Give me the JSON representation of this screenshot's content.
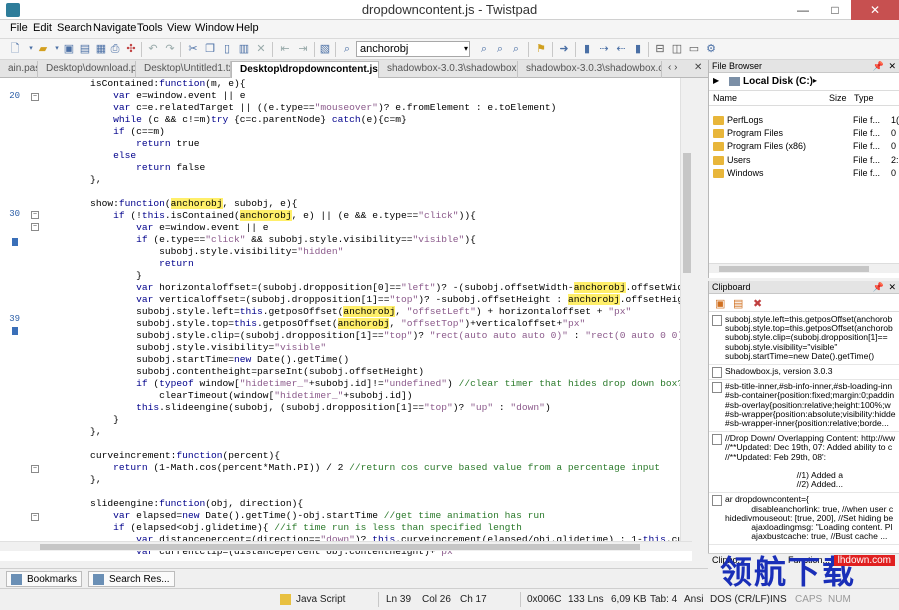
{
  "window": {
    "title": "dropdowncontent.js - Twistpad",
    "min": "—",
    "max": "□",
    "close": "✕"
  },
  "menu": [
    "File",
    "Edit",
    "Search",
    "Navigate",
    "Tools",
    "View",
    "Window",
    "Help"
  ],
  "toolbar": {
    "search_value": "anchorobj"
  },
  "tabs": [
    {
      "label": "ain.pas"
    },
    {
      "label": "Desktop\\download.php"
    },
    {
      "label": "Desktop\\Untitled1.txt"
    },
    {
      "label": "Desktop\\dropdowncontent.js",
      "active": true
    },
    {
      "label": "shadowbox-3.0.3\\shadowbox.js*"
    },
    {
      "label": "shadowbox-3.0.3\\shadowbox.css"
    }
  ],
  "tab_nav": "‹ ›",
  "tab_close": "✕",
  "line_numbers": {
    "l20": "20",
    "l30": "30",
    "l39": "39"
  },
  "file_browser": {
    "title": "File Browser",
    "location": "Local Disk (C:)",
    "columns": [
      "Name",
      "Size",
      "Type"
    ],
    "items": [
      {
        "name": "PerfLogs",
        "type": "File f...",
        "extra": "1("
      },
      {
        "name": "Program Files",
        "type": "File f...",
        "extra": "0"
      },
      {
        "name": "Program Files (x86)",
        "type": "File f...",
        "extra": "0"
      },
      {
        "name": "Users",
        "type": "File f...",
        "extra": "2:"
      },
      {
        "name": "Windows",
        "type": "File f...",
        "extra": "0"
      }
    ]
  },
  "clipboard": {
    "title": "Clipboard",
    "entries": [
      {
        "lines": [
          "subobj.style.left=this.getposOffset(anchorob",
          "subobj.style.top=this.getposOffset(anchorob",
          "subobj.style.clip=(subobj.dropposition[1]==",
          "subobj.style.visibility=\"visible\"",
          "subobj.startTime=new Date().getTime()"
        ]
      },
      {
        "lines": [
          "Shadowbox.js, version 3.0.3"
        ]
      },
      {
        "lines": [
          "#sb-title-inner,#sb-info-inner,#sb-loading-inn",
          "#sb-container{position:fixed;margin:0;paddin",
          "#sb-overlay{position:relative;height:100%;w",
          "#sb-wrapper{position:absolute;visibility:hidde",
          "#sb-wrapper-inner{position:relative;borde..."
        ]
      },
      {
        "lines": [
          "//Drop Down/ Overlapping Content: http://ww",
          "//**Updated: Dec 19th, 07: Added ability to c",
          "//**Updated: Feb 29th, 08':",
          "",
          "                              //1) Added a",
          "                              //2) Added..."
        ]
      },
      {
        "lines": [
          "ar dropdowncontent={",
          "           disableanchorlink: true, //when user c",
          "hidedivmouseout: [true, 200], //Set hiding be",
          "           ajaxloadingmsg: \"Loading content. Pl",
          "           ajaxbustcache: true, //Bust cache ..."
        ]
      }
    ]
  },
  "bottom_tabs": [
    "Bookmarks",
    "Search Res..."
  ],
  "side_tabs": [
    "Clipbo...",
    "Function..."
  ],
  "status": {
    "lang": "Java Script",
    "ln": "Ln  39",
    "col": "Col  26",
    "ch": "Ch  17",
    "code": "0x006C",
    "lines": "133 Lns",
    "size": "6,09 KB",
    "tab": "Tab: 4",
    "enc": "Ansi",
    "eol": "DOS (CR/LF)",
    "ins": "INS",
    "caps": "CAPS",
    "num": "NUM"
  },
  "watermark": {
    "text": "领航下载",
    "url": "lhdown.com"
  },
  "code": [
    {
      "t": "        isContained:function(m, e){"
    },
    {
      "t": "            var e=window.event || e",
      "k": true
    },
    {
      "t": "            var c=e.relatedTarget || ((e.type==\"mouseover\")? e.fromElement : e.toElement)",
      "k": true
    },
    {
      "t": "            while (c && c!=m)try {c=c.parentNode} catch(e){c=m}",
      "k": true
    },
    {
      "t": "            if (c==m)",
      "k": true
    },
    {
      "t": "                return true",
      "k": true
    },
    {
      "t": "            else",
      "k": true
    },
    {
      "t": "                return false",
      "k": true
    },
    {
      "t": "        },"
    },
    {
      "t": ""
    },
    {
      "t": "        show:function(anchorobj, subobj, e){"
    },
    {
      "t": "            if (!this.isContained(anchorobj, e) || (e && e.type==\"click\")){",
      "k": true
    },
    {
      "t": "                var e=window.event || e",
      "k": true
    },
    {
      "t": "                if (e.type==\"click\" && subobj.style.visibility==\"visible\"){",
      "k": true
    },
    {
      "t": "                    subobj.style.visibility=\"hidden\""
    },
    {
      "t": "                    return",
      "k": true
    },
    {
      "t": "                }"
    },
    {
      "t": "                var horizontaloffset=(subobj.dropposition[0]==\"left\")? -(subobj.offsetWidth-anchorobj.offsetWidth) : 0 //",
      "k": true
    },
    {
      "t": "                var verticaloffset=(subobj.dropposition[1]==\"top\")? -subobj.offsetHeight : anchorobj.offsetHeight //calcu",
      "k": true
    },
    {
      "t": "                subobj.style.left=this.getposOffset(anchorobj, \"offsetLeft\") + horizontaloffset + \"px\""
    },
    {
      "t": "                subobj.style.top=this.getposOffset(anchorobj, \"offsetTop\")+verticaloffset+\"px\""
    },
    {
      "t": "                subobj.style.clip=(subobj.dropposition[1]==\"top\")? \"rect(auto auto auto 0)\" : \"rect(0 auto 0 0)\" //hide d"
    },
    {
      "t": "                subobj.style.visibility=\"visible\""
    },
    {
      "t": "                subobj.startTime=new Date().getTime()"
    },
    {
      "t": "                subobj.contentheight=parseInt(subobj.offsetHeight)"
    },
    {
      "t": "                if (typeof window[\"hidetimer_\"+subobj.id]!=\"undefined\") //clear timer that hides drop down box?",
      "k": true
    },
    {
      "t": "                    clearTimeout(window[\"hidetimer_\"+subobj.id])"
    },
    {
      "t": "                this.slideengine(subobj, (subobj.dropposition[1]==\"top\")? \"up\" : \"down\")"
    },
    {
      "t": "            }"
    },
    {
      "t": "        },"
    },
    {
      "t": ""
    },
    {
      "t": "        curveincrement:function(percent){"
    },
    {
      "t": "            return (1-Math.cos(percent*Math.PI)) / 2 //return cos curve based value from a percentage input",
      "k": true
    },
    {
      "t": "        },"
    },
    {
      "t": ""
    },
    {
      "t": "        slideengine:function(obj, direction){"
    },
    {
      "t": "            var elapsed=new Date().getTime()-obj.startTime //get time animation has run",
      "k": true
    },
    {
      "t": "            if (elapsed<obj.glidetime){ //if time run is less than specified length",
      "k": true
    },
    {
      "t": "                var distancepercent=(direction==\"down\")? this.curveincrement(elapsed/obj.glidetime) : 1-this.curveincreme",
      "k": true
    },
    {
      "t": "                var currentclip=(distancepercent*obj.contentheight)+\"px\"",
      "k": true
    }
  ]
}
